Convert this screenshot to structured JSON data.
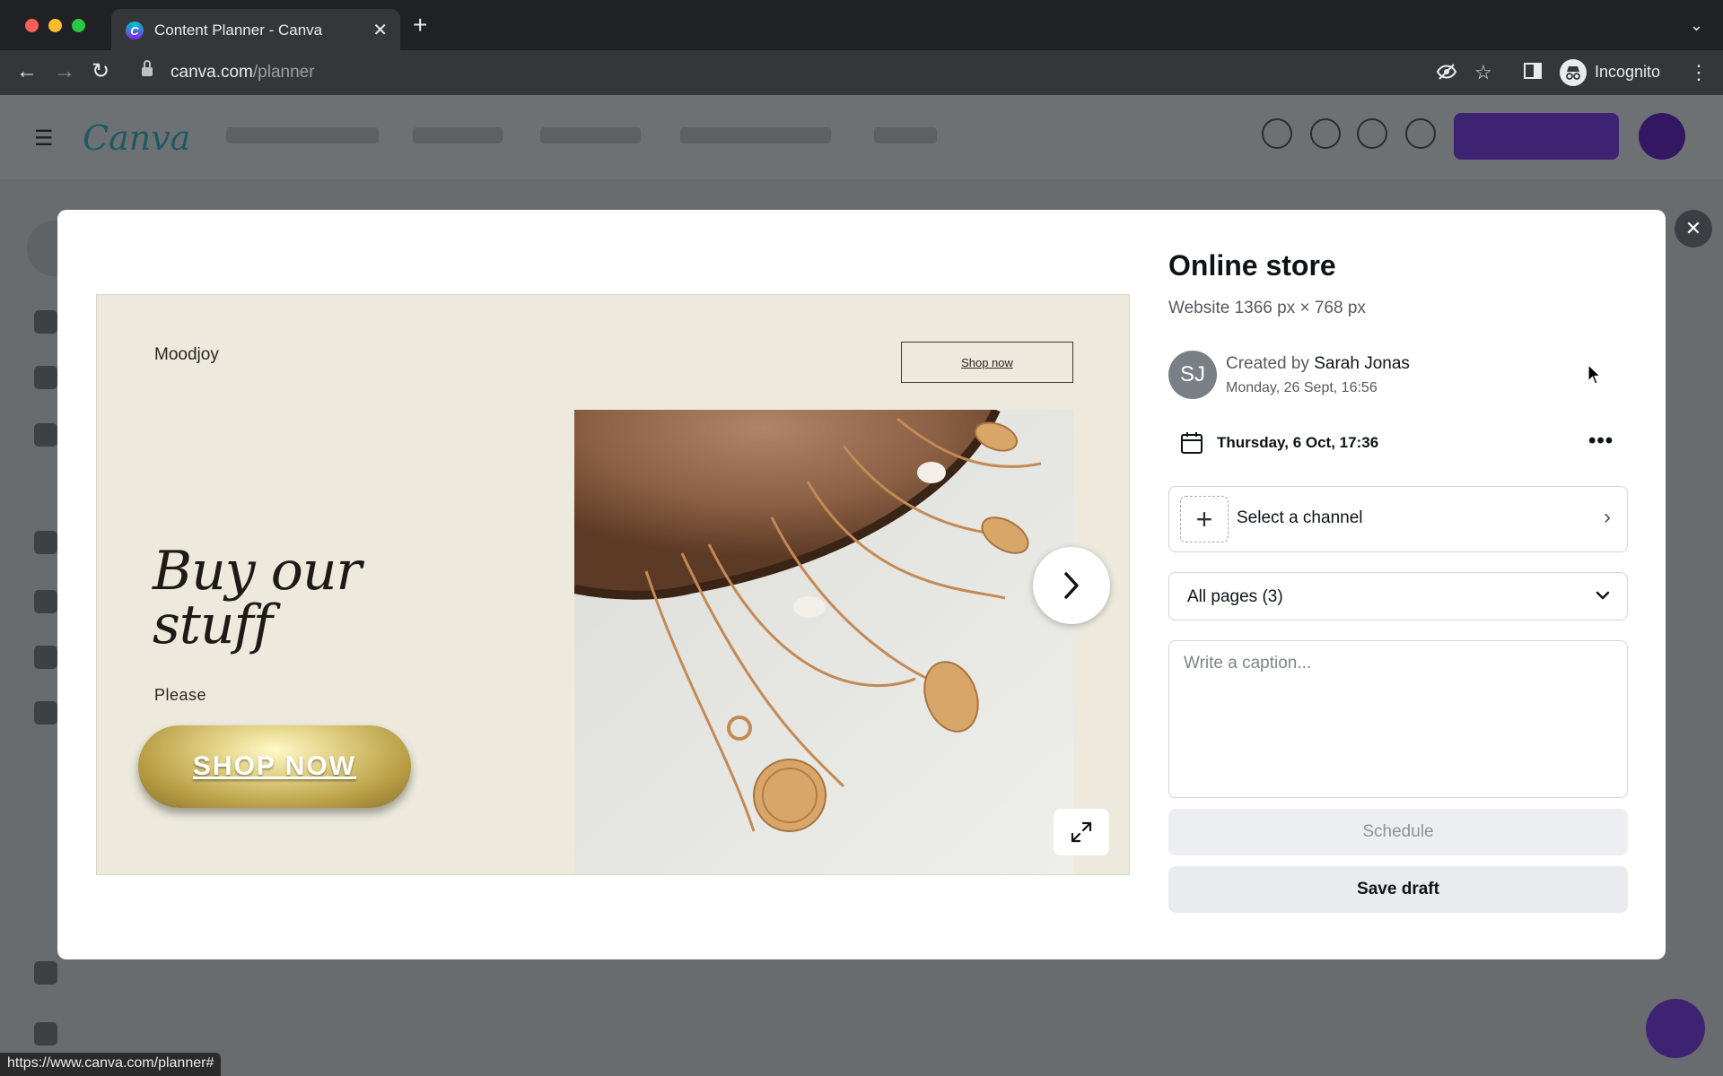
{
  "browser": {
    "tab_title": "Content Planner - Canva",
    "tab_favicon_letter": "C",
    "url_host": "canva.com",
    "url_path": "/planner",
    "profile_label": "Incognito"
  },
  "modal": {
    "preview": {
      "brand": "Moodjoy",
      "shop_link": "Shop now",
      "headline": "Buy our stuff",
      "subline": "Please",
      "cta": "SHOP NOW"
    },
    "title": "Online store",
    "dimensions": "Website 1366 px × 768 px",
    "author_initials": "SJ",
    "created_prefix": "Created by",
    "author_name": "Sarah Jonas",
    "created_date": "Monday, 26 Sept, 16:56",
    "schedule_date": "Thursday, 6 Oct, 17:36",
    "channel_label": "Select a channel",
    "pages_label": "All pages (3)",
    "caption_placeholder": "Write a caption...",
    "schedule_button": "Schedule",
    "save_draft_button": "Save draft"
  },
  "status_bar_url": "https://www.canva.com/planner#",
  "colors": {
    "accent": "#8b3dff",
    "modal_bg": "#ffffff",
    "preview_bg": "#edeadd"
  }
}
